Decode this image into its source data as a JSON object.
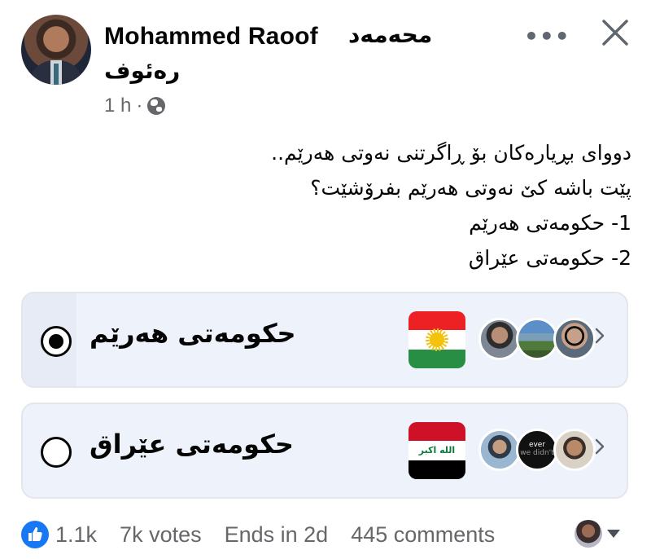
{
  "author": {
    "name_en": "Mohammed Raoof",
    "name_ku_line1": "محەمەد",
    "name_ku_line2": "رەئوف",
    "timestamp": "1 h",
    "separator": "·",
    "audience_icon": "globe-icon"
  },
  "header": {
    "more_label": "•••",
    "close_icon": "close-icon"
  },
  "post": {
    "lines": [
      "دووای بڕیارەکان بۆ ڕاگرتنی نەوتی هەرێم..",
      "پێت باشە کێ نەوتی هەرێم بفرۆشێت؟",
      "1- حکومەتی هەرێم",
      "2- حکومەتی عێراق"
    ]
  },
  "poll": {
    "options": [
      {
        "label": "حکومەتی هەرێم",
        "selected": true,
        "flag": "kurdistan-flag-icon",
        "share": 0.09
      },
      {
        "label": "حکومەتی عێراق",
        "selected": false,
        "flag": "iraq-flag-icon",
        "flag_text": "الله اكبر",
        "share": 0.0
      }
    ],
    "voter_avatar2_text": [
      "ever",
      "we didn't"
    ]
  },
  "footer": {
    "reactions": "1.1k",
    "votes": "7k votes",
    "ends": "Ends in 2d",
    "comments": "445 comments"
  },
  "colors": {
    "accent": "#1877f2",
    "option_bg": "#eef2fb",
    "secondary_text": "#65676b"
  }
}
